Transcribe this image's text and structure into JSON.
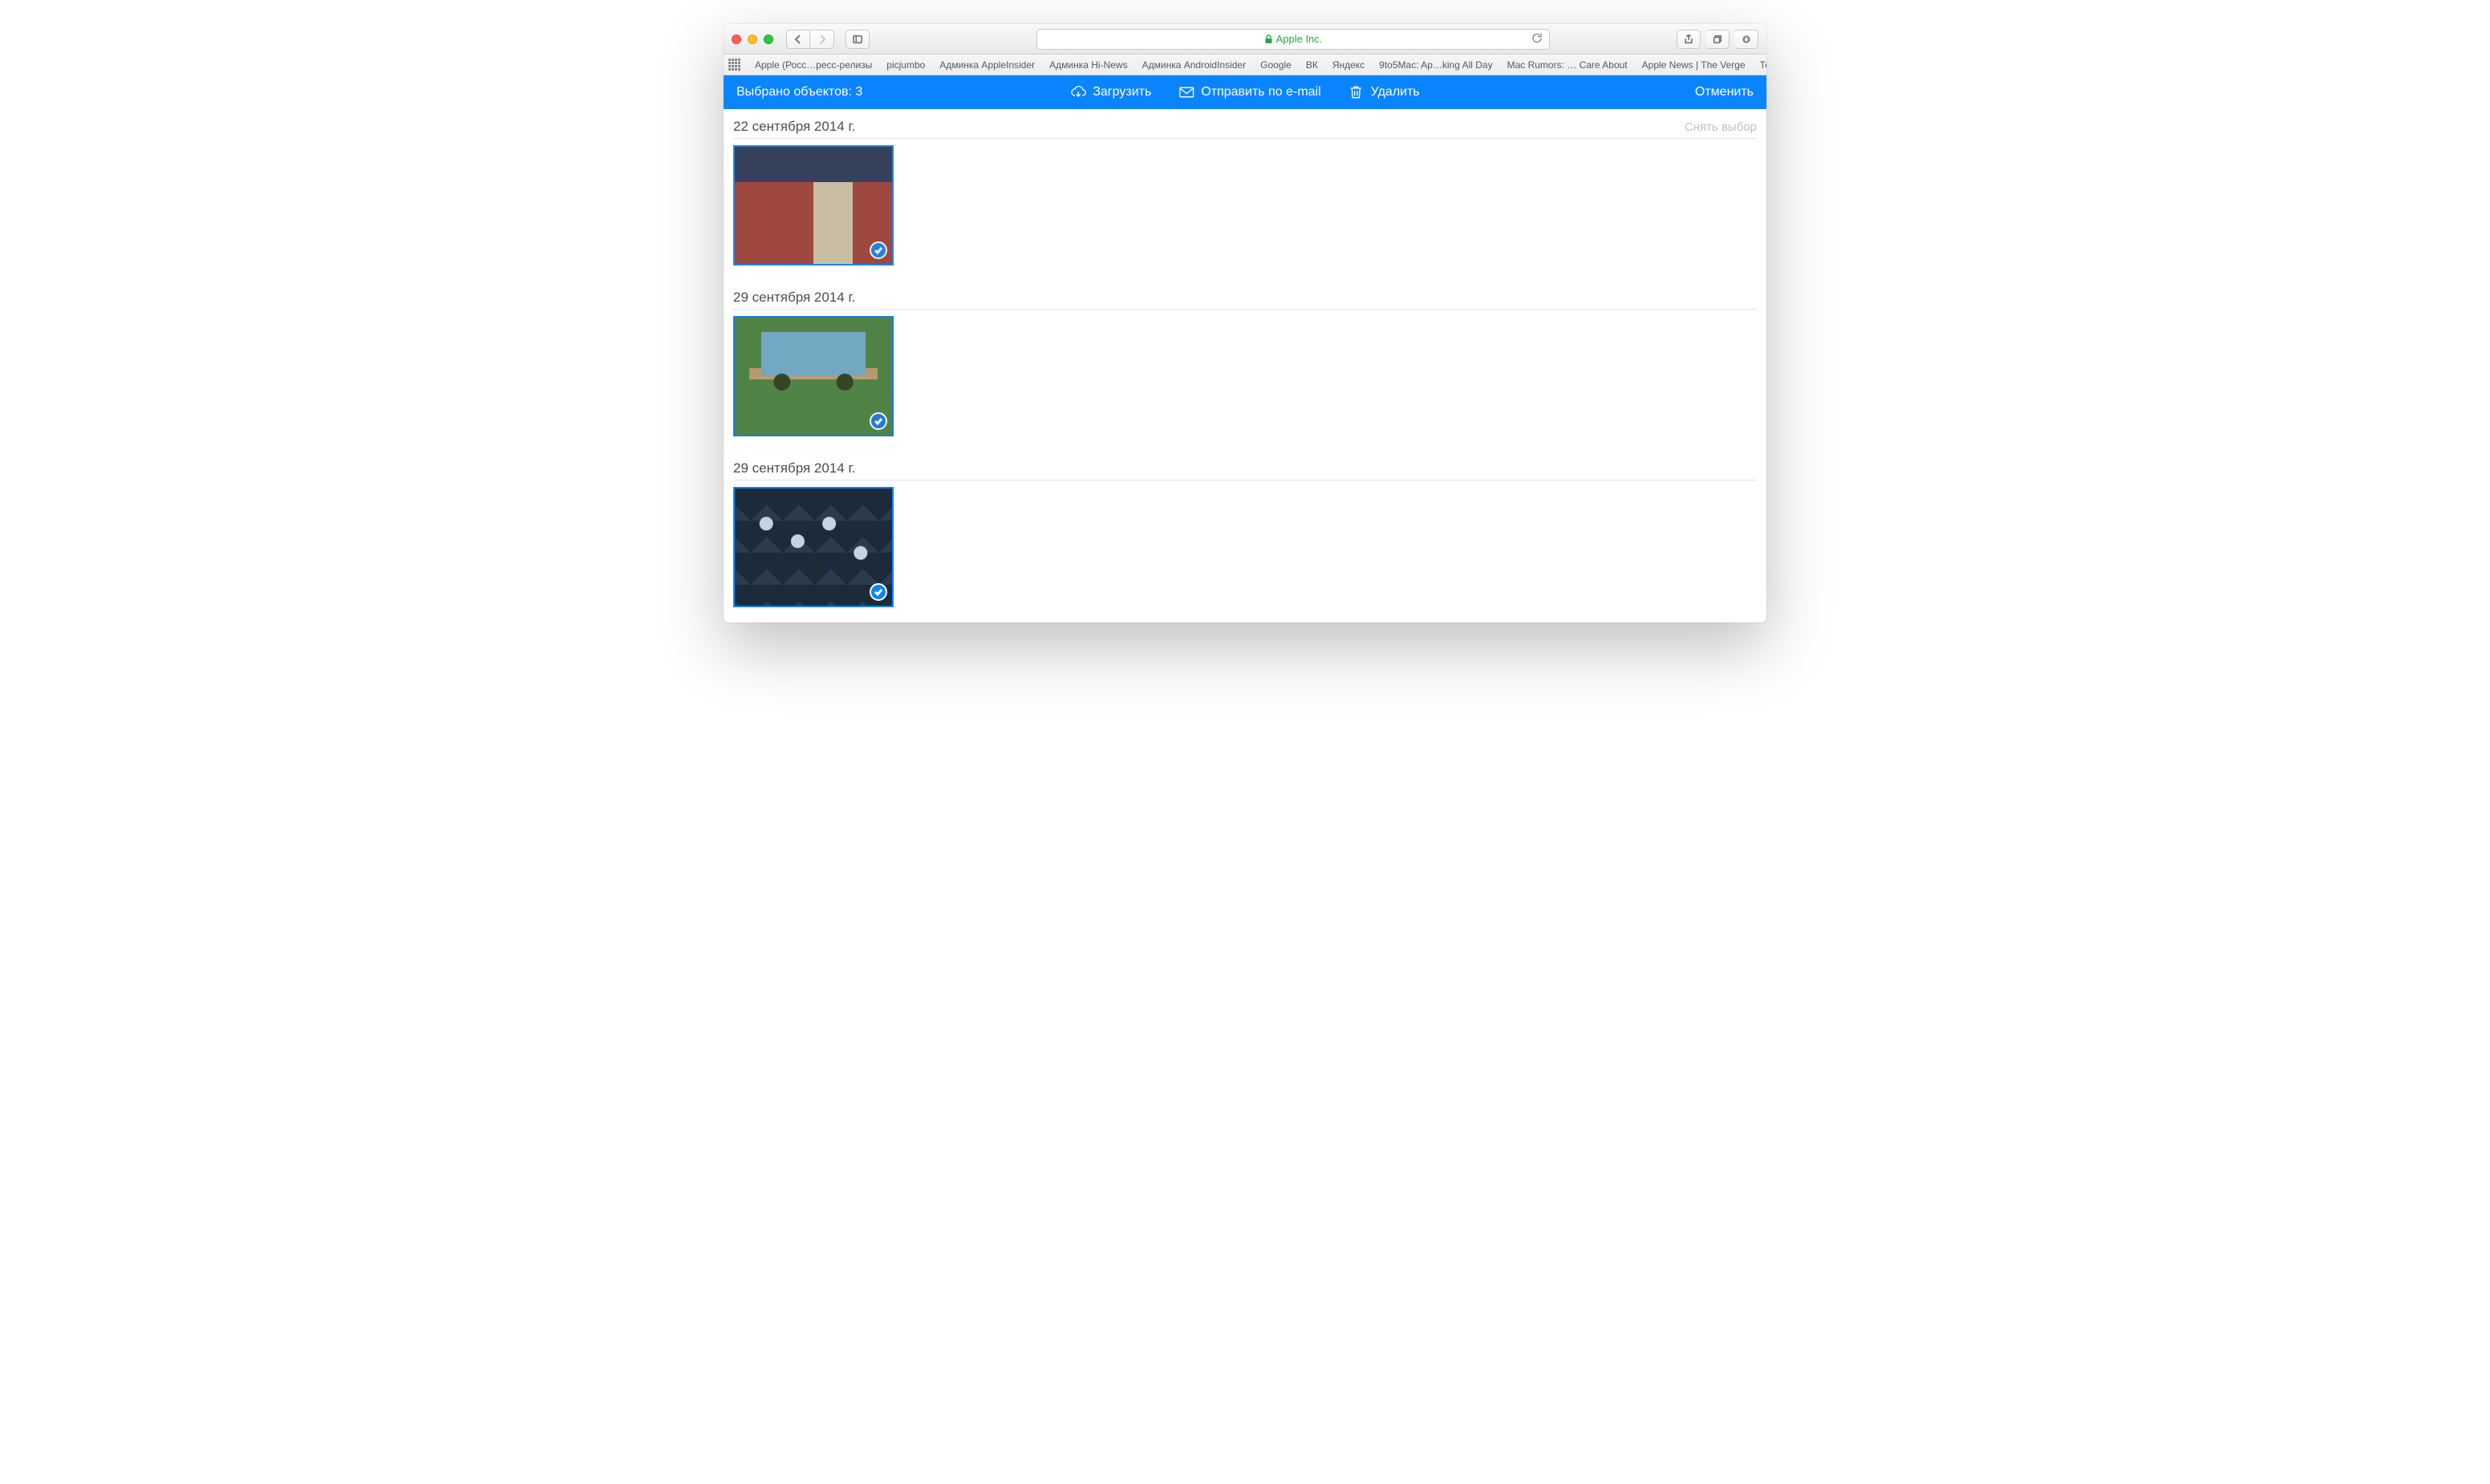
{
  "browser": {
    "address_label": "Apple Inc.",
    "favorites": [
      "Apple (Росс…ресс-релизы",
      "picjumbo",
      "Админка AppleInsider",
      "Админка Hi-News",
      "Админка AndroidInsider",
      "Google",
      "ВК",
      "Яндекс",
      "9to5Mac: Ap…king All Day",
      "Mac Rumors: … Care About",
      "Apple News | The Verge",
      "Темы"
    ]
  },
  "selection_bar": {
    "count_label": "Выбрано объектов: 3",
    "download_label": "Загрузить",
    "email_label": "Отправить по e-mail",
    "delete_label": "Удалить",
    "cancel_label": "Отменить"
  },
  "sections": [
    {
      "date": "22 сентября 2014 г.",
      "deselect": "Снять выбор"
    },
    {
      "date": "29 сентября 2014 г."
    },
    {
      "date": "29 сентября 2014 г."
    }
  ]
}
